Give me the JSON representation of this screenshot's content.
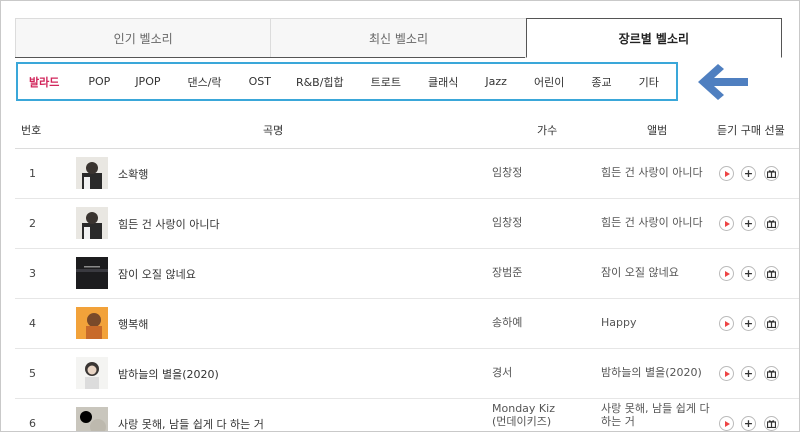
{
  "tabs": [
    "인기 벨소리",
    "최신 벨소리",
    "장르별 벨소리"
  ],
  "active_tab": 2,
  "genres": [
    "발라드",
    "POP",
    "JPOP",
    "댄스/락",
    "OST",
    "R&B/힙합",
    "트로트",
    "클래식",
    "Jazz",
    "어린이",
    "종교",
    "기타"
  ],
  "active_genre": 0,
  "colors": {
    "accent_genre": "#d1255b",
    "highlight_box": "#3aa7d9",
    "arrow": "#4f7fc0",
    "play": "#e44444"
  },
  "table": {
    "headers": {
      "num": "번호",
      "title": "곡명",
      "artist": "가수",
      "album": "앨범",
      "actions": "듣기 구매 선물"
    },
    "rows": [
      {
        "num": "1",
        "title": "소확행",
        "artist": "임창정",
        "album": "힘든 건 사랑이 아니다"
      },
      {
        "num": "2",
        "title": "힘든 건 사랑이 아니다",
        "artist": "임창정",
        "album": "힘든 건 사랑이 아니다"
      },
      {
        "num": "3",
        "title": "잠이 오질 않네요",
        "artist": "장범준",
        "album": "잠이 오질 않네요"
      },
      {
        "num": "4",
        "title": "행복해",
        "artist": "송하예",
        "album": "Happy"
      },
      {
        "num": "5",
        "title": "밤하늘의 별을(2020)",
        "artist": "경서",
        "album": "밤하늘의 별을(2020)"
      },
      {
        "num": "6",
        "title": "사랑 못해, 남들 쉽게 다 하는 거",
        "artist": "Monday Kiz\n(먼데이키즈)",
        "album": "사랑 못해, 남들 쉽게 다\n하는 거"
      }
    ]
  },
  "icons": {
    "play": "play-icon",
    "buy": "plus-icon",
    "gift": "gift-icon",
    "arrow": "left-arrow-icon"
  }
}
